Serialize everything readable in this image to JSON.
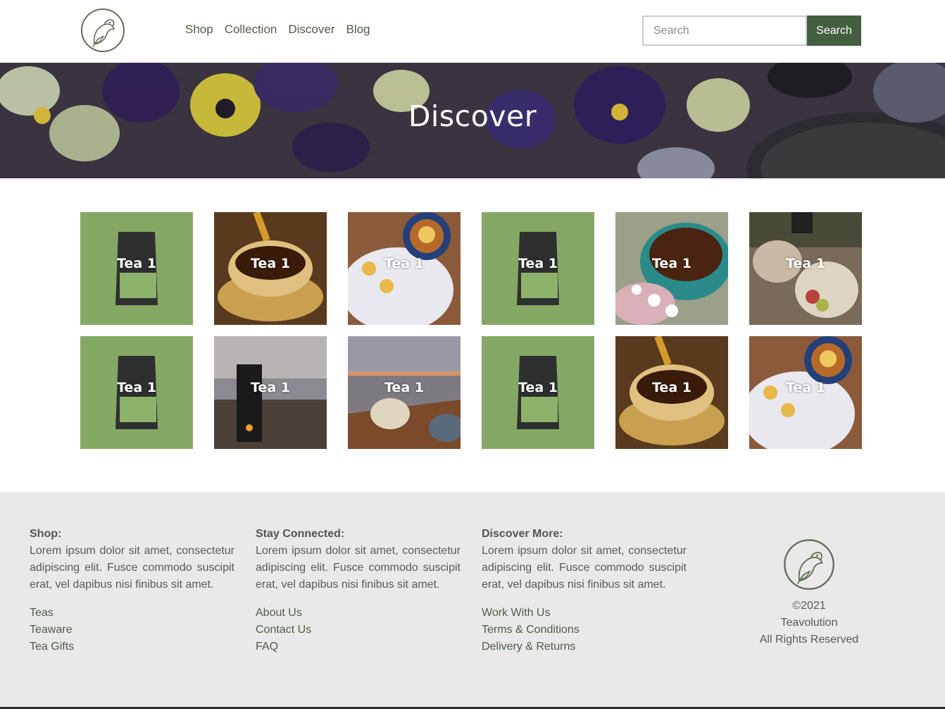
{
  "header": {
    "logo_icon": "bird-leaf-logo-icon",
    "nav": [
      "Shop",
      "Collection",
      "Discover",
      "Blog"
    ],
    "search": {
      "placeholder": "Search",
      "button_label": "Search"
    }
  },
  "hero": {
    "title": "Discover",
    "image": "pansy-flowers-and-teacup-photo"
  },
  "tiles": [
    {
      "label": "Tea 1",
      "image": "tea-bag-green-background"
    },
    {
      "label": "Tea 1",
      "image": "honey-spoon-teacup"
    },
    {
      "label": "Tea 1",
      "image": "lemon-heart-tea-plate"
    },
    {
      "label": "Tea 1",
      "image": "tea-bag-green-background"
    },
    {
      "label": "Tea 1",
      "image": "teacup-with-daisies"
    },
    {
      "label": "Tea 1",
      "image": "person-with-apples"
    },
    {
      "label": "Tea 1",
      "image": "tea-bag-green-background"
    },
    {
      "label": "Tea 1",
      "image": "lantern-at-dusk"
    },
    {
      "label": "Tea 1",
      "image": "boat-cushions-sea"
    },
    {
      "label": "Tea 1",
      "image": "tea-bag-green-background"
    },
    {
      "label": "Tea 1",
      "image": "honey-spoon-teacup"
    },
    {
      "label": "Tea 1",
      "image": "lemon-heart-tea-plate"
    }
  ],
  "footer": {
    "columns": [
      {
        "heading": "Shop:",
        "text": "Lorem ipsum dolor sit amet, consectetur adipiscing elit. Fusce commodo suscipit erat, vel dapibus nisi finibus sit amet.",
        "links": [
          "Teas",
          "Teaware",
          "Tea Gifts"
        ]
      },
      {
        "heading": "Stay Connected:",
        "text": "Lorem ipsum dolor sit amet, consectetur adipiscing elit. Fusce commodo suscipit erat, vel dapibus nisi finibus sit amet.",
        "links": [
          "About Us",
          "Contact Us",
          "FAQ"
        ]
      },
      {
        "heading": "Discover More:",
        "text": "Lorem ipsum dolor sit amet, consectetur adipiscing elit. Fusce commodo suscipit erat, vel dapibus nisi finibus sit amet.",
        "links": [
          "Work With Us",
          "Terms & Conditions",
          "Delivery & Returns"
        ]
      }
    ],
    "brand": {
      "copyright": "©2021",
      "name": "Teavolution",
      "rights": "All Rights Reserved"
    }
  },
  "colors": {
    "brand_green": "#435f3f",
    "tile_green": "#86a865",
    "footer_bg": "#e9e9e9"
  }
}
